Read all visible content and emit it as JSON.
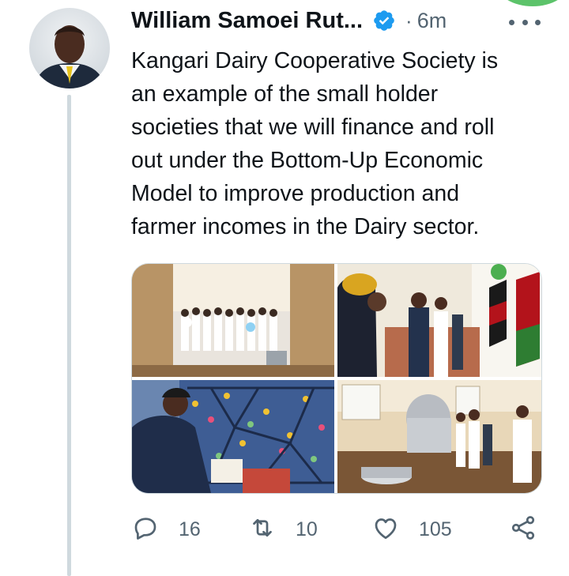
{
  "tweet": {
    "author_name": "William Samoei Rut...",
    "verified": true,
    "separator": "·",
    "time": "6m",
    "text": "Kangari Dairy Cooperative Society is\nan example of the small holder\nsocieties that we will finance and roll\nout under the Bottom-Up Economic\nModel to improve production and\nfarmer incomes in the Dairy sector."
  },
  "media": {
    "photo_count": 4
  },
  "actions": {
    "replies": "16",
    "retweets": "10",
    "likes": "105"
  },
  "icons": [
    "verified-icon",
    "more-icon",
    "reply-icon",
    "retweet-icon",
    "like-icon",
    "share-icon"
  ],
  "colors": {
    "verified_blue": "#1d9bf0",
    "secondary_text": "#536471",
    "thread_line": "#cfd9de",
    "corner_green": "#5cc36a"
  }
}
